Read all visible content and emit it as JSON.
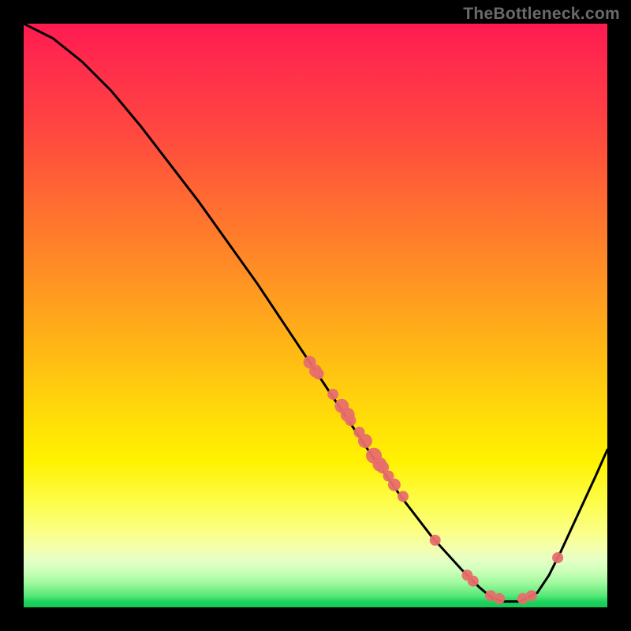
{
  "watermark": "TheBottleneck.com",
  "chart_data": {
    "type": "line",
    "title": "",
    "xlabel": "",
    "ylabel": "",
    "xlim": [
      0,
      1
    ],
    "ylim": [
      0,
      1
    ],
    "curve": [
      {
        "x": 0.0,
        "y": 1.0
      },
      {
        "x": 0.05,
        "y": 0.975
      },
      {
        "x": 0.1,
        "y": 0.935
      },
      {
        "x": 0.15,
        "y": 0.885
      },
      {
        "x": 0.2,
        "y": 0.825
      },
      {
        "x": 0.25,
        "y": 0.76
      },
      {
        "x": 0.3,
        "y": 0.695
      },
      {
        "x": 0.35,
        "y": 0.625
      },
      {
        "x": 0.4,
        "y": 0.555
      },
      {
        "x": 0.45,
        "y": 0.48
      },
      {
        "x": 0.5,
        "y": 0.405
      },
      {
        "x": 0.55,
        "y": 0.33
      },
      {
        "x": 0.6,
        "y": 0.255
      },
      {
        "x": 0.65,
        "y": 0.185
      },
      {
        "x": 0.7,
        "y": 0.12
      },
      {
        "x": 0.75,
        "y": 0.065
      },
      {
        "x": 0.78,
        "y": 0.035
      },
      {
        "x": 0.8,
        "y": 0.018
      },
      {
        "x": 0.82,
        "y": 0.01
      },
      {
        "x": 0.85,
        "y": 0.01
      },
      {
        "x": 0.88,
        "y": 0.025
      },
      {
        "x": 0.9,
        "y": 0.055
      },
      {
        "x": 0.92,
        "y": 0.095
      },
      {
        "x": 0.95,
        "y": 0.16
      },
      {
        "x": 0.98,
        "y": 0.225
      },
      {
        "x": 1.0,
        "y": 0.27
      }
    ],
    "series": [
      {
        "name": "markers",
        "color": "#e86e6b",
        "points": [
          {
            "x": 0.49,
            "y": 0.42,
            "r": 8
          },
          {
            "x": 0.5,
            "y": 0.405,
            "r": 8
          },
          {
            "x": 0.505,
            "y": 0.4,
            "r": 7
          },
          {
            "x": 0.53,
            "y": 0.365,
            "r": 7
          },
          {
            "x": 0.545,
            "y": 0.345,
            "r": 9
          },
          {
            "x": 0.555,
            "y": 0.33,
            "r": 9
          },
          {
            "x": 0.56,
            "y": 0.32,
            "r": 7
          },
          {
            "x": 0.575,
            "y": 0.3,
            "r": 7
          },
          {
            "x": 0.585,
            "y": 0.285,
            "r": 9
          },
          {
            "x": 0.6,
            "y": 0.26,
            "r": 10
          },
          {
            "x": 0.61,
            "y": 0.245,
            "r": 9
          },
          {
            "x": 0.615,
            "y": 0.24,
            "r": 8
          },
          {
            "x": 0.625,
            "y": 0.225,
            "r": 7
          },
          {
            "x": 0.635,
            "y": 0.21,
            "r": 8
          },
          {
            "x": 0.65,
            "y": 0.19,
            "r": 7
          },
          {
            "x": 0.705,
            "y": 0.115,
            "r": 7
          },
          {
            "x": 0.76,
            "y": 0.055,
            "r": 7
          },
          {
            "x": 0.77,
            "y": 0.045,
            "r": 7
          },
          {
            "x": 0.8,
            "y": 0.02,
            "r": 7
          },
          {
            "x": 0.815,
            "y": 0.015,
            "r": 7
          },
          {
            "x": 0.855,
            "y": 0.015,
            "r": 7
          },
          {
            "x": 0.87,
            "y": 0.02,
            "r": 7
          },
          {
            "x": 0.915,
            "y": 0.085,
            "r": 7
          }
        ]
      }
    ]
  }
}
